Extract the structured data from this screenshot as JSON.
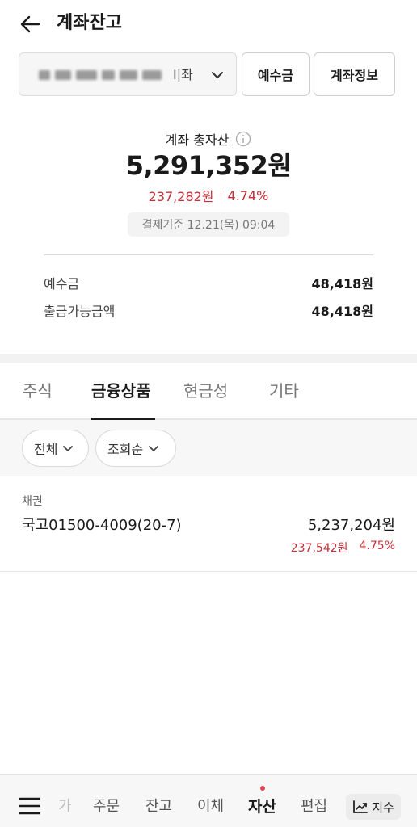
{
  "header": {
    "title": "계좌잔고"
  },
  "account_selector": {
    "suffix": "I|좌"
  },
  "header_buttons": {
    "deposit": "예수금",
    "account_info": "계좌정보"
  },
  "summary": {
    "total_label": "계좌 총자산",
    "total_amount": "5,291,352원",
    "profit_amount": "237,282원",
    "profit_rate": "4.74%",
    "basis": "결제기준 12.21(목) 09:04",
    "rows": [
      {
        "label": "예수금",
        "value": "48,418원"
      },
      {
        "label": "출금가능금액",
        "value": "48,418원"
      }
    ]
  },
  "tabs": [
    {
      "label": "주식"
    },
    {
      "label": "금융상품"
    },
    {
      "label": "현금성"
    },
    {
      "label": "기타"
    }
  ],
  "filters": {
    "type": "전체",
    "sort": "조회순"
  },
  "holdings": [
    {
      "category": "채권",
      "name": "국고01500-4009(20-7)",
      "value": "5,237,204원",
      "profit": "237,542원",
      "rate": "4.75%"
    }
  ],
  "bottom_nav": {
    "items": [
      {
        "label": "가"
      },
      {
        "label": "주문"
      },
      {
        "label": "잔고"
      },
      {
        "label": "이체"
      },
      {
        "label": "자산"
      },
      {
        "label": "편집"
      }
    ],
    "index_label": "지수"
  },
  "colors": {
    "profit": "#c8303a",
    "notice_dot": "#e04450"
  }
}
